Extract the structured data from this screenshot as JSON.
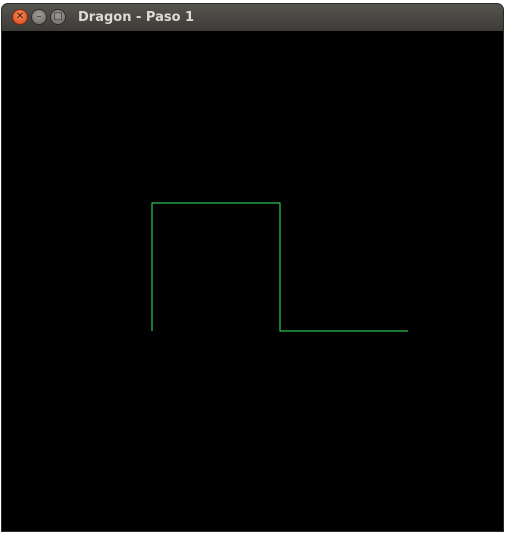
{
  "window": {
    "title": "Dragon - Paso 1",
    "close_icon": "close-icon",
    "minimize_icon": "minimize-icon",
    "maximize_icon": "maximize-icon"
  },
  "canvas": {
    "background": "#000000",
    "stroke_color": "#33ee66"
  }
}
